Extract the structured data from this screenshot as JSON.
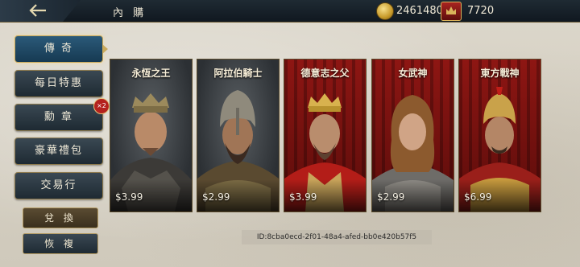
{
  "topbar": {
    "title": "內 購",
    "back_icon": "back-arrow-icon",
    "gold_amount": "2461480",
    "gem_amount": "7720",
    "gold_icon": "gold-coin-icon",
    "gem_icon": "premium-badge-icon"
  },
  "menu": {
    "items": [
      {
        "label": "傳 奇",
        "active": true
      },
      {
        "label": "每日特惠",
        "active": false
      },
      {
        "label": "勳 章",
        "active": false
      },
      {
        "label": "豪華禮包",
        "active": false
      },
      {
        "label": "交易行",
        "active": false
      }
    ],
    "medal_badge": "×2",
    "exchange_label": "兌 換",
    "restore_label": "恢 複"
  },
  "cards": [
    {
      "name": "永恆之王",
      "price": "$3.99",
      "bg": "gray"
    },
    {
      "name": "阿拉伯騎士",
      "price": "$2.99",
      "bg": "gray"
    },
    {
      "name": "德意志之父",
      "price": "$3.99",
      "bg": "red"
    },
    {
      "name": "女武神",
      "price": "$2.99",
      "bg": "red"
    },
    {
      "name": "東方戰神",
      "price": "$6.99",
      "bg": "red"
    }
  ],
  "footer": {
    "id_text": "ID:8cba0ecd-2f01-48a4-afed-bb0e420b57f5"
  },
  "colors": {
    "topbar": "#101820",
    "accent_gold": "#c9a95a",
    "curtain_red": "#8e1613"
  }
}
